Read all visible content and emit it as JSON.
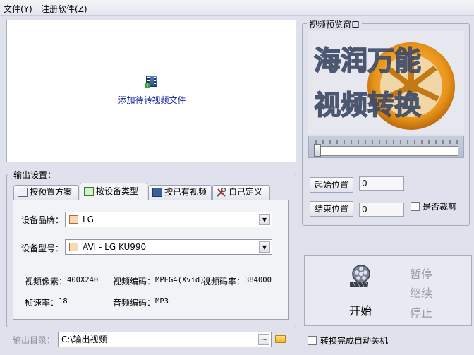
{
  "menu": {
    "file": "文件(Y)",
    "register": "注册软件(Z)"
  },
  "dropzone": {
    "add_link": "添加待转视频文件"
  },
  "output_settings": {
    "title": "输出设置：",
    "tabs": [
      {
        "label": "按预置方案"
      },
      {
        "label": "按设备类型"
      },
      {
        "label": "按已有视频"
      },
      {
        "label": "自己定义"
      }
    ],
    "brand_label": "设备品牌：",
    "brand_value": "LG",
    "model_label": "设备型号：",
    "model_value": "AVI - LG KU990",
    "resolution_label": "视频像素：",
    "resolution_value": "400X240",
    "vcodec_label": "视频编码：",
    "vcodec_value": "MPEG4(Xvid)",
    "vbitrate_label": "视频码率：",
    "vbitrate_value": "384000",
    "fps_label": "桢速率：",
    "fps_value": "18",
    "acodec_label": "音频编码：",
    "acodec_value": "MP3"
  },
  "preview": {
    "title": "视频预览窗口",
    "time_text": "--",
    "start_button": "起始位置",
    "start_value": "0",
    "end_button": "结束位置",
    "end_value": "0",
    "crop_label": "是否裁剪",
    "crop_checked": false,
    "logo_line1": "海润万能",
    "logo_line2": "视频转换"
  },
  "controls": {
    "start": "开始",
    "pause": "暂停",
    "resume": "继续",
    "stop": "停止"
  },
  "output": {
    "dir_label": "输出目录：",
    "dir_value": "C:\\输出视频",
    "browse_label": "...",
    "shutdown_label": "转换完成自动关机",
    "shutdown_checked": false
  },
  "colors": {
    "background": "#dfe2ec",
    "link": "#1020a0",
    "disabled_text": "#9a9ca6",
    "logo_orange": "#e8941a"
  }
}
